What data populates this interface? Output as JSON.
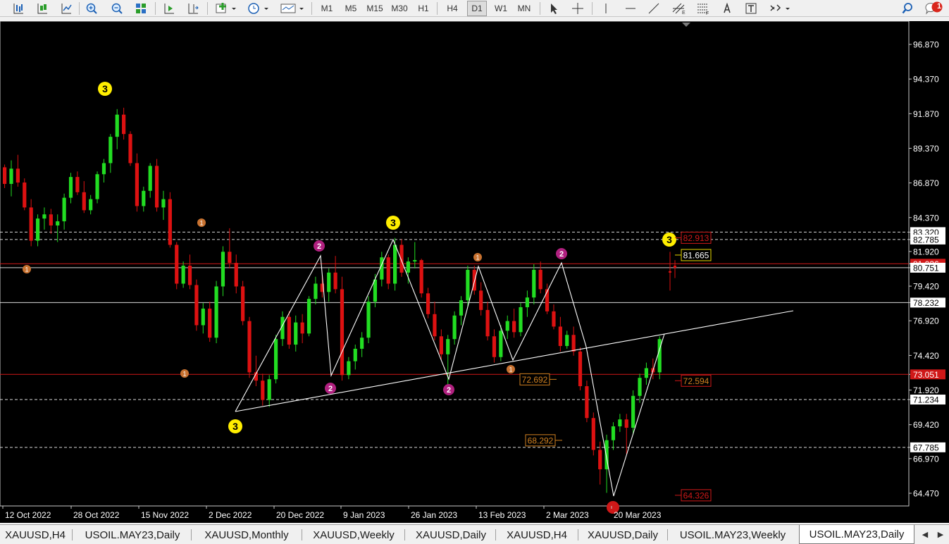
{
  "toolbar": {
    "timeframes": [
      "M1",
      "M5",
      "M15",
      "M30",
      "H1",
      "H4",
      "D1",
      "W1",
      "MN"
    ],
    "active_timeframe": "D1",
    "notification_count": "1"
  },
  "chart": {
    "background": "#000000",
    "bull_color": "#22dd22",
    "bear_color": "#dd1111",
    "price_labels": [
      "96.870",
      "94.370",
      "91.870",
      "89.370",
      "86.870",
      "84.370",
      "83.320",
      "82.785",
      "81.920",
      "81.036",
      "80.751",
      "79.420",
      "78.232",
      "76.920",
      "74.420",
      "73.051",
      "71.920",
      "71.234",
      "69.420",
      "67.785",
      "66.970",
      "64.470"
    ],
    "date_labels": [
      "12 Oct 2022",
      "28 Oct 2022",
      "15 Nov 2022",
      "2 Dec 2022",
      "20 Dec 2022",
      "9 Jan 2023",
      "26 Jan 2023",
      "13 Feb 2023",
      "2 Mar 2023",
      "20 Mar 2023"
    ],
    "levels": {
      "red_top": "82.913",
      "yellow": "81.665",
      "red_current": "81.036",
      "white_mid": "78.232",
      "orange_1": "72.692",
      "red_mid": "72.594",
      "red_line": "73.051",
      "white_low": "71.234",
      "orange_2": "68.292",
      "white_bottom": "67.785",
      "red_bottom": "64.326"
    },
    "wave_labels": {
      "yellow": [
        "3",
        "3",
        "3",
        "3"
      ],
      "magenta": [
        "2",
        "2",
        "2",
        "2"
      ],
      "orange": [
        "1",
        "1",
        "1",
        "1",
        "1"
      ]
    }
  },
  "tabs": [
    {
      "label": "XAUUSD,H4"
    },
    {
      "label": "USOIL.MAY23,Daily"
    },
    {
      "label": "XAUUSD,Monthly"
    },
    {
      "label": "XAUUSD,Weekly"
    },
    {
      "label": "XAUUSD,Daily"
    },
    {
      "label": "XAUUSD,H4"
    },
    {
      "label": "XAUUSD,Daily"
    },
    {
      "label": "USOIL.MAY23,Weekly"
    },
    {
      "label": "USOIL.MAY23,Daily"
    }
  ],
  "active_tab_index": 8
}
